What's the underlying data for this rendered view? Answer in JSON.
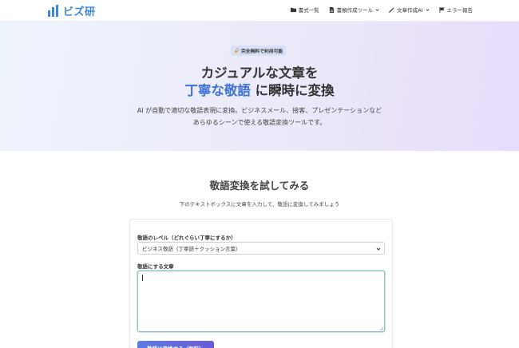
{
  "header": {
    "logo_text": "ビズ研",
    "nav": [
      {
        "label": "書式一覧",
        "icon": "folder-icon"
      },
      {
        "label": "書類作成ツール",
        "icon": "document-icon"
      },
      {
        "label": "文章作成AI",
        "icon": "magic-wand-icon"
      },
      {
        "label": "エラー報告",
        "icon": "flag-icon"
      }
    ]
  },
  "hero": {
    "badge": "完全無料で利用可能",
    "title_line1": "カジュアルな文章を",
    "title_highlight": "丁寧な敬語",
    "title_line2_rest": " に瞬時に変換",
    "desc_line1": "AI が自動で適切な敬語表現に変換。ビジネスメール、接客、プレゼンテーションなど",
    "desc_line2": "あらゆるシーンで使える敬語変換ツールです。"
  },
  "tool": {
    "title": "敬語変換を試してみる",
    "subtitle": "下のテキストボックスに文章を入力して、敬語に変換してみましょう",
    "level_label": "敬語のレベル（どれぐらい丁寧にするか）",
    "level_selected": "ビジネス敬語（丁寧語＋クッション言葉）",
    "text_label": "敬語にする文章",
    "text_value": "",
    "button_label": "敬語に変換する（無料）"
  },
  "colors": {
    "brand": "#3d86d9",
    "highlight": "#3e72d8",
    "button_start": "#5b7be6",
    "button_end": "#6a5ad8"
  }
}
